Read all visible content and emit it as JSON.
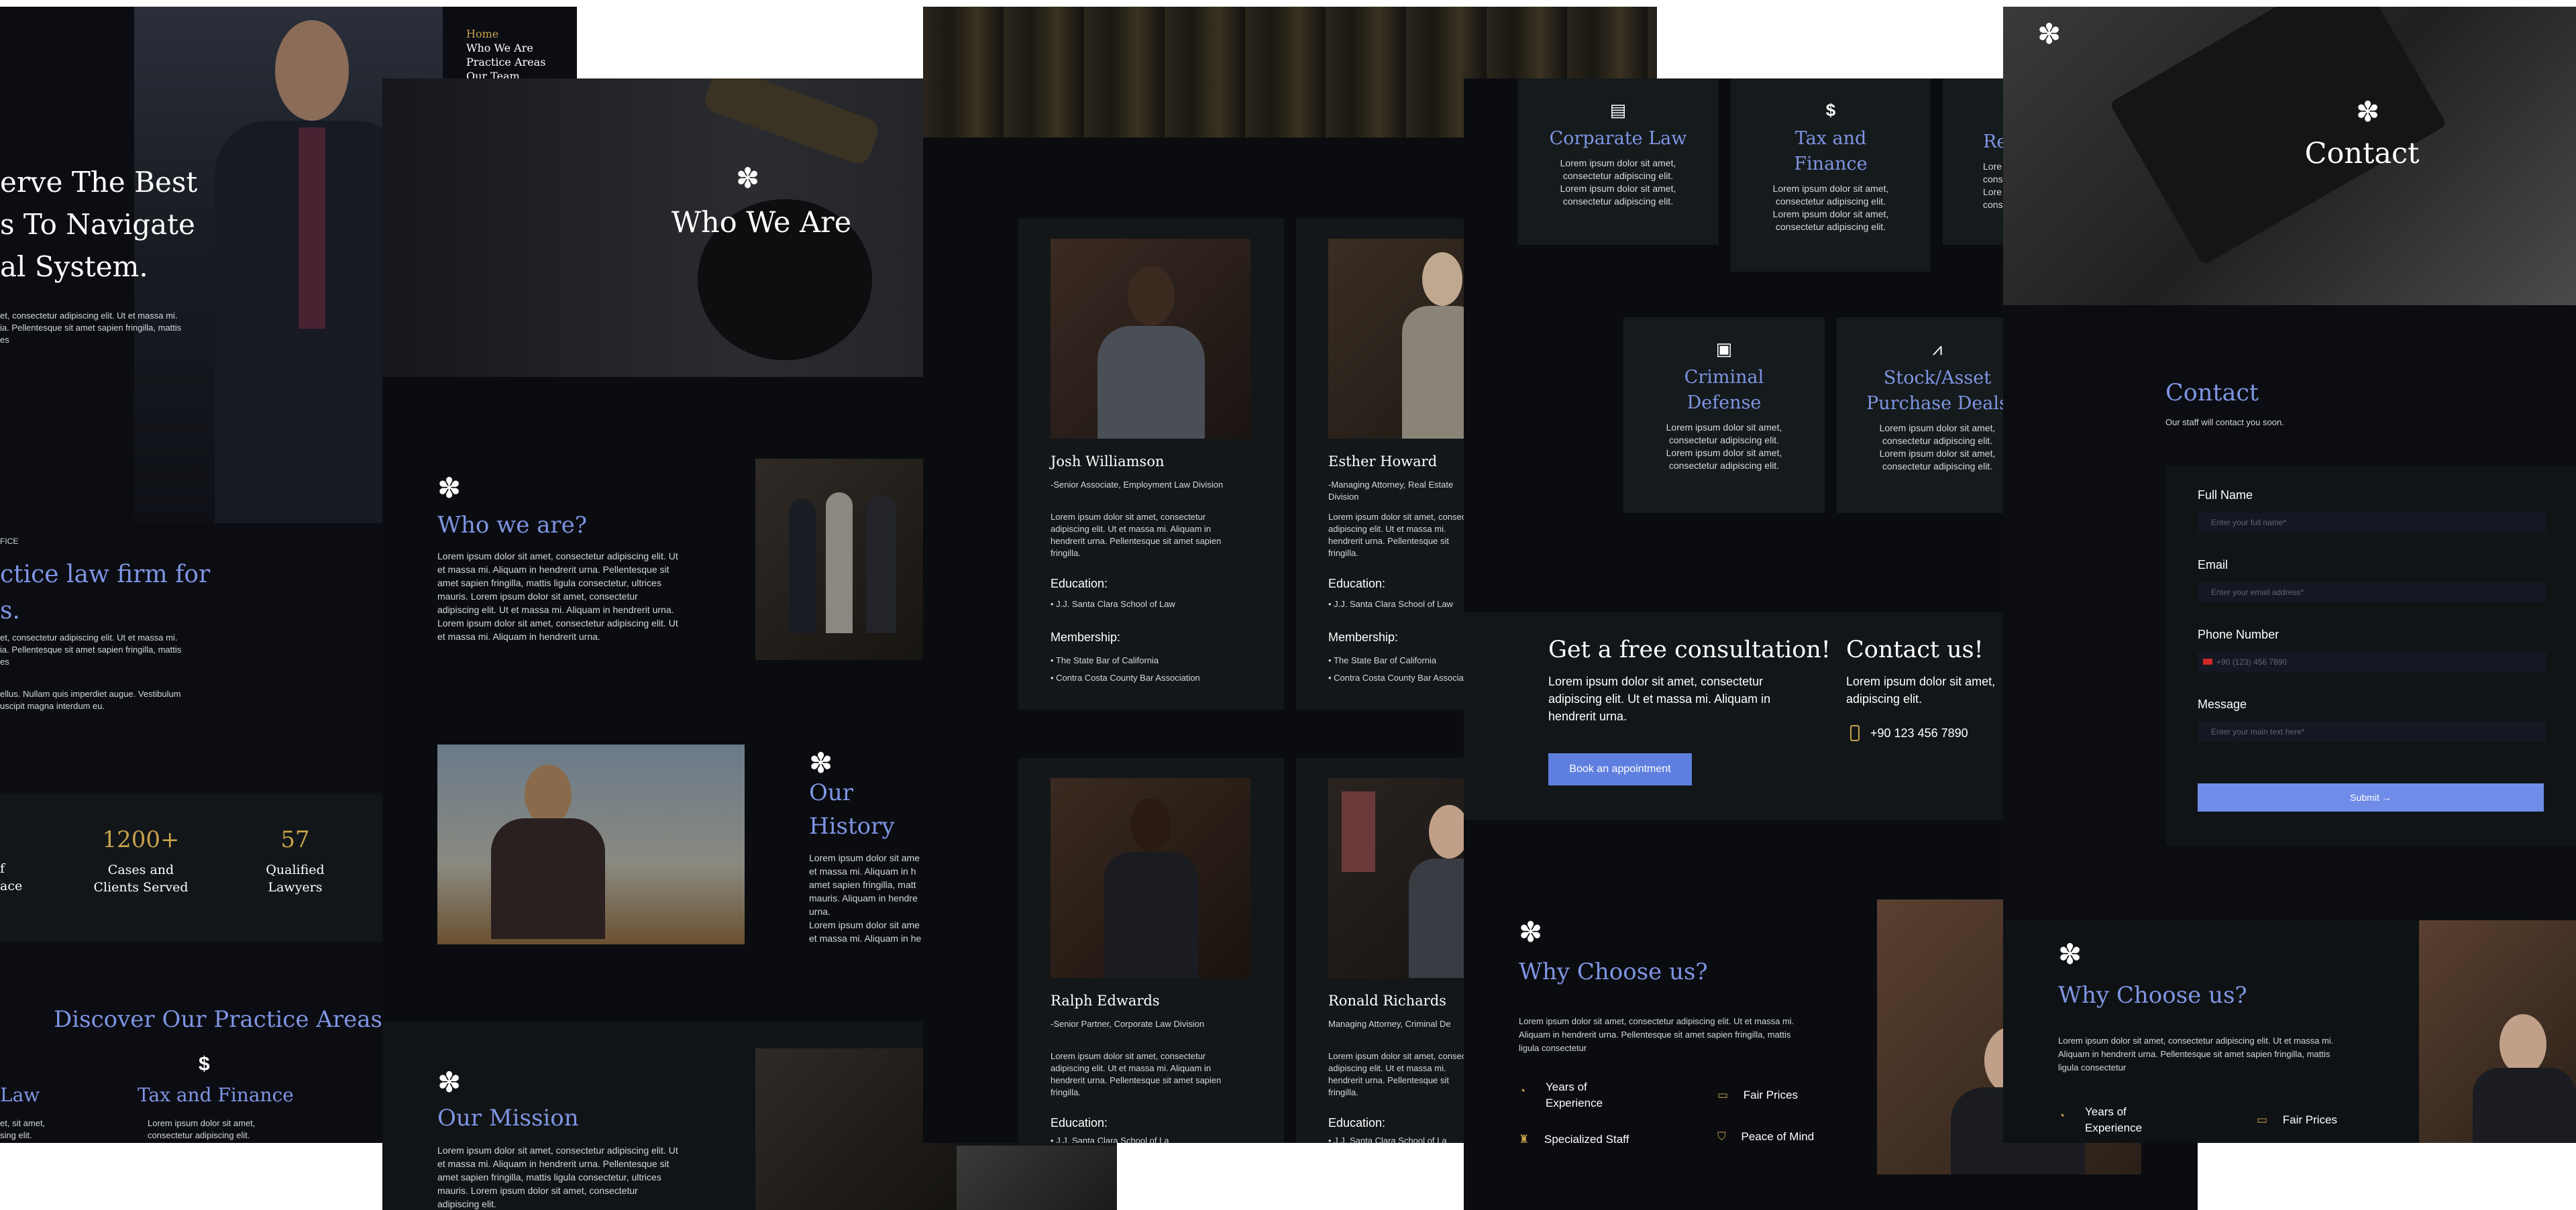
{
  "colors": {
    "bg": "#0a0c11",
    "card": "#141719",
    "accent_blue": "#7f95e4",
    "accent_gold": "#c8a24c",
    "button": "#5f7fe0"
  },
  "home": {
    "nav": [
      "Home",
      "Who We Are",
      "Practice Areas",
      "Our Team"
    ],
    "hero_lines": [
      "erve The Best",
      "s To Navigate",
      "al System."
    ],
    "hero_text": [
      "et, consectetur adipiscing elit. Ut et massa mi.",
      "ia. Pellentesque sit amet sapien fringilla, mattis",
      "es"
    ],
    "office_label": "FICE",
    "subheading_lines": [
      "ctice law firm for",
      "s."
    ],
    "para1": [
      "et, consectetur adipiscing elit. Ut et massa mi.",
      "ia. Pellentesque sit amet sapien fringilla, mattis",
      "es"
    ],
    "para2": [
      "ellus. Nullam quis imperdiet augue. Vestibulum",
      "uscipit magna interdum eu."
    ],
    "stats": [
      {
        "num": "",
        "label": [
          "f",
          "ace"
        ]
      },
      {
        "num": "1200+",
        "label": [
          "Cases and",
          "Clients Served"
        ]
      },
      {
        "num": "57",
        "label": [
          "Qualified",
          "Lawyers"
        ]
      }
    ],
    "discover_title": "Discover Our Practice Areas",
    "practice": [
      {
        "icon": "",
        "title": "Law",
        "desc": [
          "et, sit amet,",
          "sing elit."
        ]
      },
      {
        "icon": "$",
        "title": "Tax and Finance",
        "desc": [
          "Lorem ipsum dolor sit amet,",
          "consectetur adipiscing elit."
        ]
      }
    ]
  },
  "who": {
    "hero_title": "Who We Are",
    "section1_title": "Who we are?",
    "section1_text": [
      "Lorem ipsum dolor sit amet, consectetur adipiscing elit. Ut",
      "et massa mi. Aliquam in hendrerit urna. Pellentesque sit",
      "amet sapien fringilla, mattis ligula consectetur, ultrices",
      "mauris. Lorem ipsum dolor sit amet, consectetur",
      "adipiscing elit. Ut et massa mi. Aliquam in hendrerit urna.",
      "Lorem ipsum dolor sit amet, consectetur adipiscing elit. Ut",
      "et massa mi. Aliquam in hendrerit urna."
    ],
    "history_title": [
      "Our",
      "History"
    ],
    "history_text": [
      "Lorem ipsum dolor sit ame",
      "et massa mi. Aliquam in h",
      "amet sapien fringilla, matt",
      "mauris. Aliquam in hendre",
      "urna.",
      "Lorem ipsum dolor sit ame",
      "et massa mi. Aliquam in he"
    ],
    "mission_title": "Our Mission",
    "mission_text": [
      "Lorem ipsum dolor sit amet, consectetur adipiscing elit. Ut",
      "et massa mi. Aliquam in hendrerit urna. Pellentesque sit",
      "amet sapien fringilla, mattis ligula consectetur, ultrices",
      "mauris. Lorem ipsum dolor sit amet, consectetur",
      "adipiscing elit."
    ]
  },
  "team": {
    "members": [
      {
        "name": "Josh Williamson",
        "role": [
          "-Senior Associate, Employment Law Division"
        ],
        "bio": [
          "Lorem ipsum dolor sit amet, consectetur",
          "adipiscing elit. Ut et massa mi. Aliquam in",
          "hendrerit urna. Pellentesque sit amet sapien",
          "fringilla."
        ],
        "edu_label": "Education:",
        "edu": [
          "J.J. Santa Clara School of Law"
        ],
        "mem_label": "Membership:",
        "mem": [
          "The State Bar of California",
          "Contra Costa County Bar Association"
        ]
      },
      {
        "name": "Esther Howard",
        "role": [
          "-Managing Attorney, Real Estate",
          "Division"
        ],
        "bio": [
          "Lorem ipsum dolor sit amet, consectetur",
          "adipiscing elit. Ut et massa mi.",
          "hendrerit urna. Pellentesque sit",
          "fringilla."
        ],
        "edu_label": "Education:",
        "edu": [
          "J.J. Santa Clara School of Law"
        ],
        "mem_label": "Membership:",
        "mem": [
          "The State Bar of California",
          "Contra Costa County Bar Associat"
        ]
      },
      {
        "name": "Ralph Edwards",
        "role": [
          "-Senior Partner, Corporate Law Division"
        ],
        "bio": [
          "Lorem ipsum dolor sit amet, consectetur",
          "adipiscing elit. Ut et massa mi. Aliquam in",
          "hendrerit urna. Pellentesque sit amet sapien",
          "fringilla."
        ],
        "edu_label": "Education:",
        "edu": [
          "J.J. Santa Clara School of La"
        ]
      },
      {
        "name": "Ronald Richards",
        "role": [
          "Managing Attorney, Criminal De"
        ],
        "bio": [
          "Lorem ipsum dolor sit amet, consectetur",
          "adipiscing elit. Ut et massa mi.",
          "hendrerit urna. Pellentesque sit",
          "fringilla."
        ],
        "edu_label": "Education:",
        "edu": [
          "J.J. Santa Clara School of La"
        ]
      }
    ]
  },
  "practice": {
    "cards": [
      {
        "icon": "document-icon",
        "glyph": "▤",
        "title": [
          "Corparate Law"
        ],
        "desc": [
          "Lorem ipsum dolor sit amet,",
          "consectetur adipiscing elit.",
          "Lorem ipsum dolor sit amet,",
          "consectetur adipiscing elit."
        ]
      },
      {
        "icon": "dollar-icon",
        "glyph": "$",
        "title": [
          "Tax and",
          "Finance"
        ],
        "desc": [
          "Lorem ipsum dolor sit amet,",
          "consectetur adipiscing elit.",
          "Lorem ipsum dolor sit amet,",
          "consectetur adipiscing elit."
        ]
      },
      {
        "icon": "",
        "glyph": "",
        "title": [
          "Re"
        ],
        "desc": [
          "Lore",
          "cons",
          "Lore",
          "cons"
        ]
      },
      {
        "icon": "briefcase-icon",
        "glyph": "▣",
        "title": [
          "Criminal",
          "Defense"
        ],
        "desc": [
          "Lorem ipsum dolor sit amet,",
          "consectetur adipiscing elit.",
          "Lorem ipsum dolor sit amet,",
          "consectetur adipiscing elit."
        ]
      },
      {
        "icon": "chart-icon",
        "glyph": "⩘",
        "title": [
          "Stock/Asset",
          "Purchase Deals"
        ],
        "desc": [
          "Lorem ipsum dolor sit amet,",
          "consectetur adipiscing elit.",
          "Lorem ipsum dolor sit amet,",
          "consectetur adipiscing elit."
        ]
      }
    ],
    "consult_title": "Get a free consultation!",
    "consult_text": [
      "Lorem ipsum dolor sit amet, consectetur",
      "adipiscing elit. Ut et massa mi. Aliquam in",
      "hendrerit urna."
    ],
    "consult_button": "Book an appointment",
    "contact_title": "Contact us!",
    "contact_text": [
      "Lorem ipsum dolor sit amet,",
      "adipiscing elit."
    ],
    "phone": "+90 123 456 7890",
    "why_title": "Why Choose us?",
    "why_text": [
      "Lorem ipsum dolor sit amet, consectetur adipiscing elit. Ut et massa mi.",
      "Aliquam in hendrerit urna. Pellentesque sit amet sapien fringilla, mattis",
      "ligula consectetur"
    ],
    "features": [
      [
        "Years of",
        "Experience"
      ],
      [
        "Fair Prices"
      ],
      [
        "Specialized Staff"
      ],
      [
        "Peace of Mind"
      ]
    ]
  },
  "contact": {
    "hero_title": "Contact",
    "title": "Contact",
    "subtitle": "Our staff will contact you soon.",
    "fields": [
      {
        "label": "Full Name",
        "placeholder": "Enter your full name*"
      },
      {
        "label": "Email",
        "placeholder": "Enter your email address*"
      },
      {
        "label": "Phone Number",
        "placeholder": "+90 (123) 456 7890"
      },
      {
        "label": "Message",
        "placeholder": "Enter your main text here*"
      }
    ],
    "submit": "Submit",
    "why_title": "Why Choose us?",
    "why_text": [
      "Lorem ipsum dolor sit amet, consectetur adipiscing elit. Ut et massa mi.",
      "Aliquam in hendrerit urna. Pellentesque sit amet sapien fringilla, mattis",
      "ligula consectetur"
    ],
    "features": [
      [
        "Years of",
        "Experience"
      ],
      [
        "Fair Prices"
      ]
    ]
  }
}
